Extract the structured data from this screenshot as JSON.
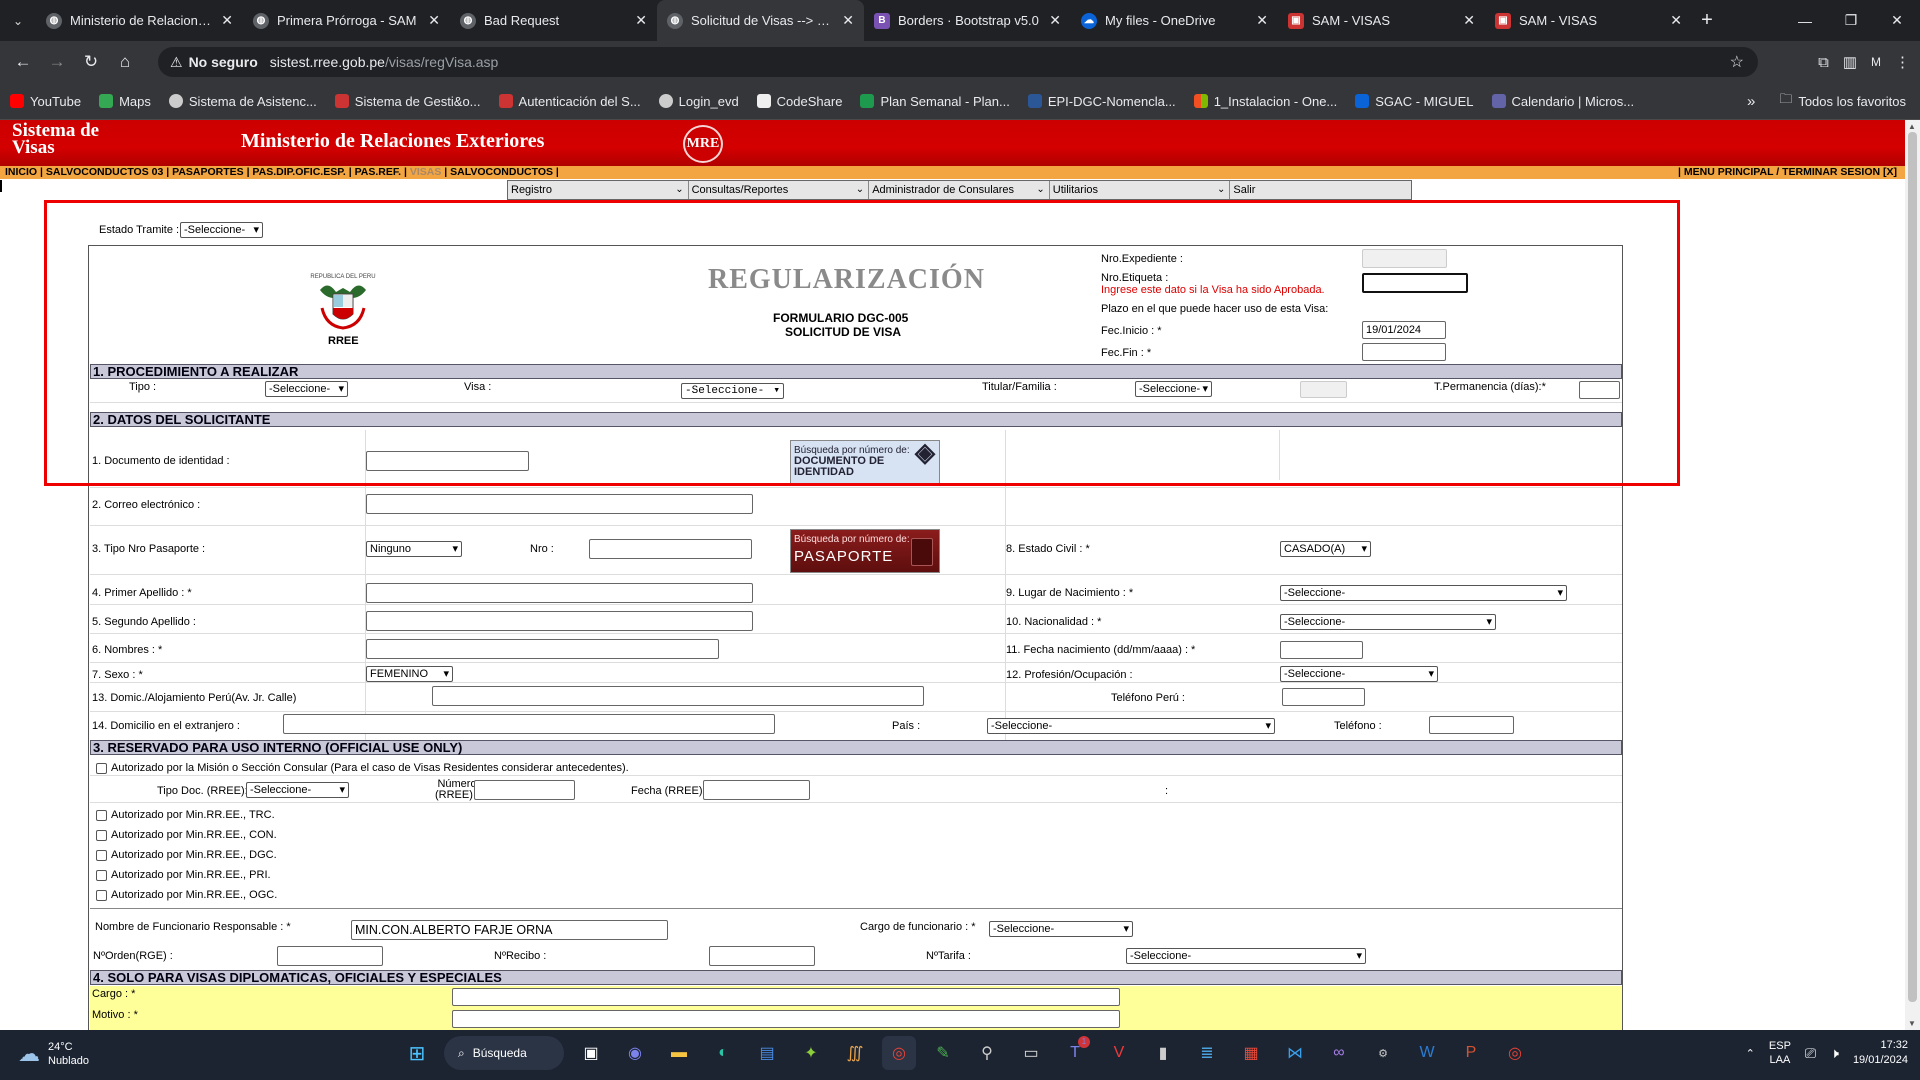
{
  "browser": {
    "tabs": [
      {
        "title": "Ministerio de Relaciones E",
        "icon": "globe-icon",
        "active": false
      },
      {
        "title": "Primera Prórroga - SAM",
        "icon": "globe-icon",
        "active": false
      },
      {
        "title": "Bad Request",
        "icon": "globe-icon",
        "active": false
      },
      {
        "title": "Solicitud de Visas --> MIN",
        "icon": "globe-icon",
        "active": true
      },
      {
        "title": "Borders · Bootstrap v5.0",
        "icon": "bootstrap-icon",
        "active": false
      },
      {
        "title": "My files - OneDrive",
        "icon": "onedrive-icon",
        "active": false
      },
      {
        "title": "SAM - VISAS",
        "icon": "sam-icon",
        "active": false
      },
      {
        "title": "SAM - VISAS",
        "icon": "sam-icon",
        "active": false
      }
    ],
    "omnibox": {
      "security": "No seguro",
      "host": "sistest.rree.gob.pe",
      "path": "/visas/regVisa.asp"
    },
    "profile": "M",
    "bookmarks": [
      "YouTube",
      "Maps",
      "Sistema de Asistenc...",
      "Sistema de Gesti&o...",
      "Autenticación del S...",
      "Login_evd",
      "CodeShare",
      "Plan Semanal - Plan...",
      "EPI-DGC-Nomencla...",
      "1_Instalacion - One...",
      "SGAC - MIGUEL",
      "Calendario | Micros..."
    ],
    "bookmarks_more": "»",
    "all_bookmarks": "Todos los favoritos"
  },
  "site": {
    "system_name": "Sistema de Visas",
    "ministry": "Ministerio de Relaciones Exteriores",
    "seal": "MRE",
    "nav_left": "INICIO | SALVOCONDUCTOS 03 | PASAPORTES | PAS.DIP.OFIC.ESP. | PAS.REF. |",
    "nav_current": "VISAS",
    "nav_after": "| SALVOCONDUCTOS |",
    "nav_right": "| MENU PRINCIPAL /   TERMINAR SESION [X]",
    "menu": [
      "Registro",
      "Consultas/Reportes",
      "Administrador de Consulares",
      "Utilitarios",
      "Salir"
    ]
  },
  "form": {
    "estado_tramite_label": "Estado Tramite :",
    "estado_tramite_value": "-Seleccione-",
    "escudo_text": "REPUBLICA DEL PERU",
    "rree": "RREE",
    "title": "REGULARIZACIÓN",
    "subtitle1": "FORMULARIO DGC-005",
    "subtitle2": "SOLICITUD DE VISA",
    "nro_expediente": "Nro.Expediente :",
    "nro_etiqueta": "Nro.Etiqueta :",
    "etiqueta_hint": "Ingrese este dato si la Visa ha sido Aprobada.",
    "plazo": "Plazo en el que puede hacer uso de esta Visa:",
    "fec_inicio": "Fec.Inicio : *",
    "fec_inicio_value": "19/01/2024",
    "fec_fin": "Fec.Fin : *",
    "section1": "1. PROCEDIMIENTO A REALIZAR",
    "tipo": "Tipo :",
    "visa": "Visa :",
    "titular": "Titular/Familia :",
    "permanencia": "T.Permanencia (días):*",
    "seleccione": "-Seleccione-",
    "section2": "2. DATOS DEL SOLICITANTE",
    "doc_identidad": "1. Documento de identidad :",
    "busqueda": "Búsqueda por número de:",
    "busqueda_doc": "DOCUMENTO DE IDENTIDAD",
    "busqueda_pas": "PASAPORTE",
    "correo": "2. Correo electrónico :",
    "tipo_pasaporte": "3. Tipo Nro Pasaporte :",
    "tipo_pasaporte_value": "Ninguno",
    "nro": "Nro :",
    "estado_civil": "8. Estado Civil : *",
    "estado_civil_value": "CASADO(A)",
    "primer_apellido": "4. Primer Apellido : *",
    "lugar_nacimiento": "9. Lugar de Nacimiento : *",
    "segundo_apellido": "5. Segundo Apellido :",
    "nacionalidad": "10. Nacionalidad : *",
    "nombres": "6. Nombres : *",
    "fecha_nac": "11. Fecha nacimiento (dd/mm/aaaa) : *",
    "sexo": "7. Sexo : *",
    "sexo_value": "FEMENINO",
    "profesion": "12. Profesión/Ocupación :",
    "domicilio_peru": "13. Domic./Alojamiento Perú(Av. Jr. Calle)",
    "telefono_peru": "Teléfono Perú :",
    "domicilio_ext": "14. Domicilio en el extranjero :",
    "pais": "País :",
    "telefono": "Teléfono :",
    "section3": "3. RESERVADO PARA USO INTERNO (OFFICIAL USE ONLY)",
    "autorizado_mision": "Autorizado por la Misión o Sección Consular (Para el caso de Visas Residentes considerar antecedentes).",
    "tipo_doc": "Tipo Doc. (RREE):",
    "numero": "Número",
    "numero2": "(RREE) :",
    "fecha_rree": "Fecha (RREE):",
    "colon": ":",
    "autorizados": [
      "Autorizado por Min.RR.EE., TRC.",
      "Autorizado por Min.RR.EE., CON.",
      "Autorizado por Min.RR.EE., DGC.",
      "Autorizado por Min.RR.EE., PRI.",
      "Autorizado por Min.RR.EE., OGC."
    ],
    "funcionario": "Nombre de Funcionario Responsable : *",
    "funcionario_value": "MIN.CON.ALBERTO FARJE ORNA",
    "cargo_funcionario": "Cargo de funcionario : *",
    "norden": "NºOrden(RGE) :",
    "nrecibo": "NºRecibo :",
    "ntarifa": "NºTarifa :",
    "section4": "4. SOLO PARA VISAS DIPLOMATICAS, OFICIALES Y ESPECIALES",
    "cargo": "Cargo : *",
    "motivo": "Motivo : *"
  },
  "taskbar": {
    "temp": "24°C",
    "weather": "Nublado",
    "search": "Búsqueda",
    "lang1": "ESP",
    "lang2": "LAA",
    "time": "17:32",
    "date": "19/01/2024",
    "badge": "1"
  },
  "colors": {
    "header_red": "#cc0000",
    "nav_orange": "#f2a541",
    "highlight_box": "#ee0000",
    "section_bar": "#c8c8d8",
    "yellow_area": "#ffff99"
  }
}
